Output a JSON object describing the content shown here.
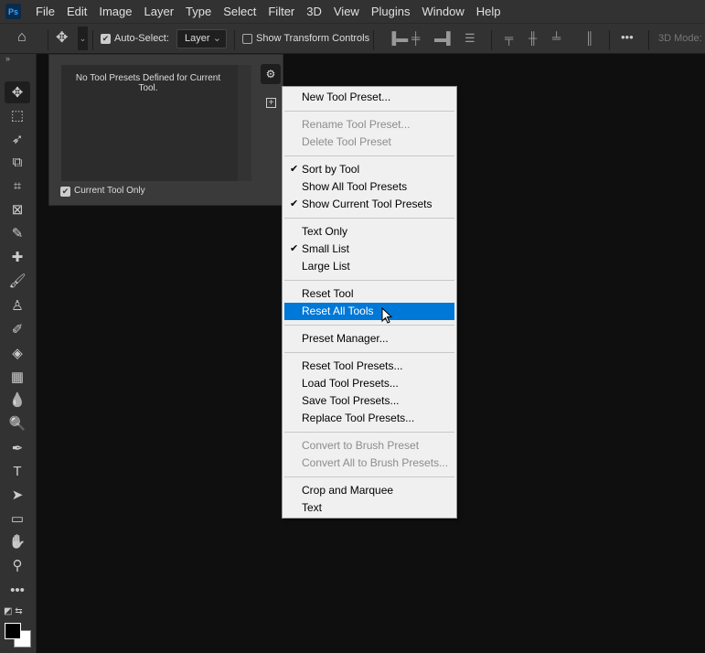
{
  "app": {
    "logo": "Ps"
  },
  "menubar": [
    "File",
    "Edit",
    "Image",
    "Layer",
    "Type",
    "Select",
    "Filter",
    "3D",
    "View",
    "Plugins",
    "Window",
    "Help"
  ],
  "options": {
    "auto_select_label": "Auto-Select:",
    "auto_select_checked": true,
    "layer_select": "Layer",
    "show_transform_label": "Show Transform Controls",
    "show_transform_checked": false,
    "mode_label": "3D Mode:"
  },
  "panel": {
    "empty_message": "No Tool Presets Defined for Current Tool.",
    "current_tool_only_label": "Current Tool Only",
    "current_tool_only_checked": true
  },
  "menu": {
    "groups": [
      [
        {
          "label": "New Tool Preset..."
        }
      ],
      [
        {
          "label": "Rename Tool Preset...",
          "disabled": true
        },
        {
          "label": "Delete Tool Preset",
          "disabled": true
        }
      ],
      [
        {
          "label": "Sort by Tool",
          "checked": true
        },
        {
          "label": "Show All Tool Presets"
        },
        {
          "label": "Show Current Tool Presets",
          "checked": true
        }
      ],
      [
        {
          "label": "Text Only"
        },
        {
          "label": "Small List",
          "checked": true
        },
        {
          "label": "Large List"
        }
      ],
      [
        {
          "label": "Reset Tool"
        },
        {
          "label": "Reset All Tools",
          "highlighted": true
        }
      ],
      [
        {
          "label": "Preset Manager..."
        }
      ],
      [
        {
          "label": "Reset Tool Presets..."
        },
        {
          "label": "Load Tool Presets..."
        },
        {
          "label": "Save Tool Presets..."
        },
        {
          "label": "Replace Tool Presets..."
        }
      ],
      [
        {
          "label": "Convert to Brush Preset",
          "disabled": true
        },
        {
          "label": "Convert All to Brush Presets...",
          "disabled": true
        }
      ],
      [
        {
          "label": "Crop and Marquee"
        },
        {
          "label": "Text"
        }
      ]
    ]
  },
  "tools": [
    "move",
    "rectangular-marquee",
    "lasso",
    "object-selection",
    "crop",
    "frame",
    "eyedropper",
    "healing-brush",
    "brush",
    "clone-stamp",
    "history-brush",
    "eraser",
    "gradient",
    "blur",
    "dodge",
    "pen",
    "type",
    "path-selection",
    "rectangle",
    "hand",
    "zoom",
    "more-tools"
  ],
  "colors": {
    "foreground": "#000000",
    "background": "#ffffff",
    "highlight": "#0078d7"
  }
}
